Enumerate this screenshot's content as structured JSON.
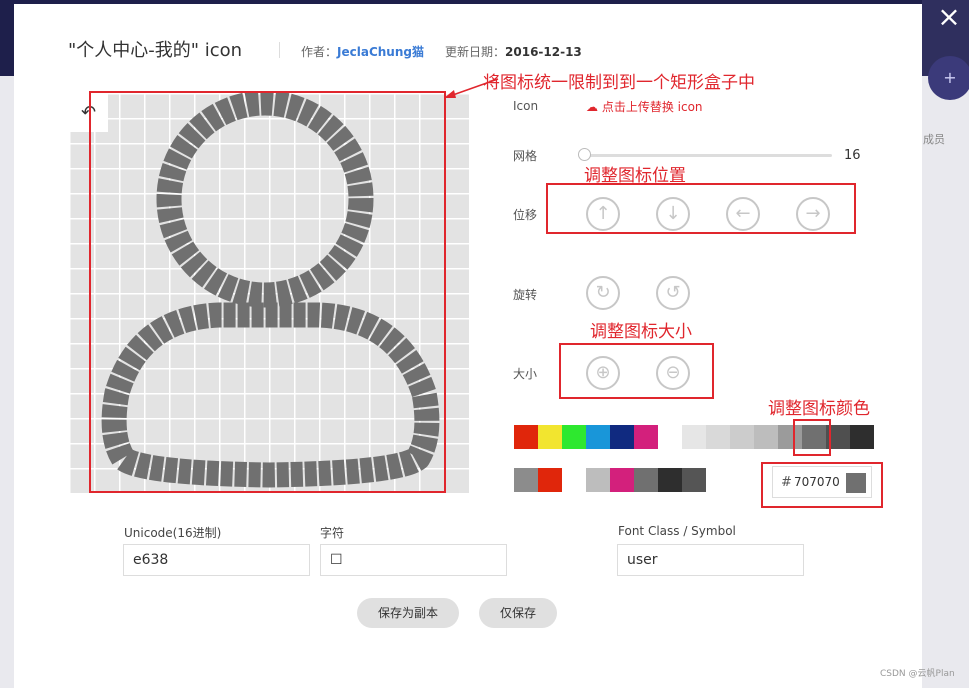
{
  "dialog": {
    "title": "\"个人中心-我的\"  icon",
    "author_label": "作者：",
    "author_name": "JeclaChung猫",
    "date_label": "更新日期：",
    "date_value": "2016-12-13",
    "close_icon": "×"
  },
  "editor": {
    "undo_icon": "↶",
    "icon_label": "Icon",
    "upload_text": "点击上传替换 icon",
    "grid_label": "网格",
    "grid_value": "16",
    "move_label": "位移",
    "rotate_label": "旋转",
    "size_label": "大小",
    "move_buttons": [
      "↑",
      "↓",
      "←",
      "→"
    ],
    "rotate_buttons": [
      "↻",
      "↺"
    ],
    "size_buttons": [
      "⊕",
      "⊖"
    ]
  },
  "colors": {
    "icon_color": "#707070",
    "row1": [
      "#e0260b",
      "#f2e52f",
      "#2ee82f",
      "#1996d9",
      "#102a80",
      "#d3207c",
      "#ffffff",
      "#e6e6e6",
      "#d9d9d9",
      "#cccccc",
      "#bdbdbd",
      "#9b9b9b",
      "#707070",
      "#4f4f4f",
      "#2e2e2e"
    ],
    "row2": [
      "#8c8c8c",
      "#e0260b",
      "#ffffff",
      "#bdbdbd",
      "#d3207c",
      "#707070",
      "#2e2e2e",
      "#555555"
    ],
    "hex_prefix": "#",
    "hex_value": "707070"
  },
  "annotations": {
    "box_note": "将图标统一限制到到一个矩形盒子中",
    "position_note": "调整图标位置",
    "size_note": "调整图标大小",
    "color_note": "调整图标颜色"
  },
  "fields": {
    "unicode_label": "Unicode(16进制)",
    "unicode_value": "e638",
    "char_label": "字符",
    "char_value": "☐",
    "class_label": "Font Class / Symbol",
    "class_value": "user"
  },
  "actions": {
    "save_copy": "保存为副本",
    "save_only": "仅保存"
  },
  "background": {
    "member_text": "成员",
    "add_folder_icon": "+"
  },
  "watermark": "CSDN @云帆Plan"
}
